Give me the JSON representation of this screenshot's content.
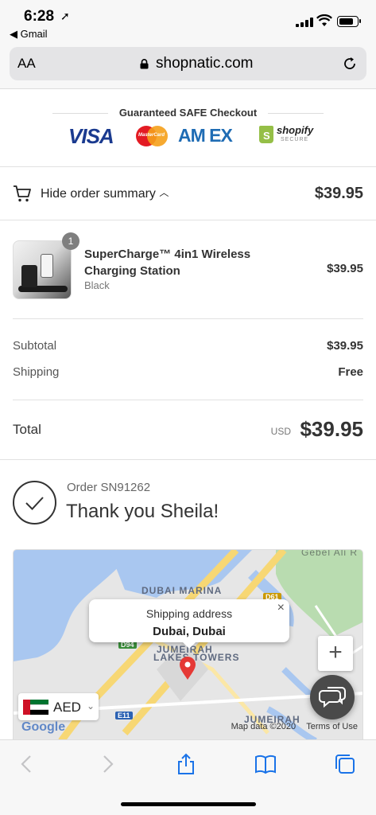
{
  "status_bar": {
    "time": "6:28",
    "back_app": "◀ Gmail"
  },
  "browser": {
    "text_size_label": "AA",
    "domain": "shopnatic.com"
  },
  "guarantee": {
    "title": "Guaranteed SAFE Checkout",
    "visa": "VISA",
    "mastercard": "MasterCard",
    "amex": "AM EX",
    "shopify": "shopify",
    "shopify_secure": "SECURE"
  },
  "summary": {
    "toggle_label": "Hide order summary",
    "total": "$39.95"
  },
  "product": {
    "quantity": "1",
    "name": "SuperCharge™ 4in1 Wireless Charging Station",
    "variant": "Black",
    "price": "$39.95"
  },
  "costs": {
    "subtotal_label": "Subtotal",
    "subtotal_value": "$39.95",
    "shipping_label": "Shipping",
    "shipping_value": "Free",
    "total_label": "Total",
    "total_currency": "USD",
    "total_value": "$39.95"
  },
  "confirmation": {
    "order_number": "Order SN91262",
    "thank_you": "Thank you Sheila!"
  },
  "map": {
    "labels": {
      "marina": "DUBAI MARINA",
      "jumeirah": "JUMEIRAH",
      "lakes_towers": "LAKES TOWERS",
      "jumeirah_south": "JUMEIRAH",
      "gebel": "Gebel Ali R"
    },
    "road_tags": {
      "d61": "D61",
      "d94": "D94",
      "e11": "E11"
    },
    "popup_title": "Shipping address",
    "popup_value": "Dubai, Dubai",
    "popup_close": "×",
    "zoom_in": "+",
    "currency": "AED",
    "google_logo": "Google",
    "map_data": "Map data ©2020",
    "terms": "Terms of Use"
  },
  "colors": {
    "accent_text": "#333333",
    "map_road": "#f7d774",
    "map_water": "#a9c7f0",
    "map_park": "#b9dcb0"
  }
}
